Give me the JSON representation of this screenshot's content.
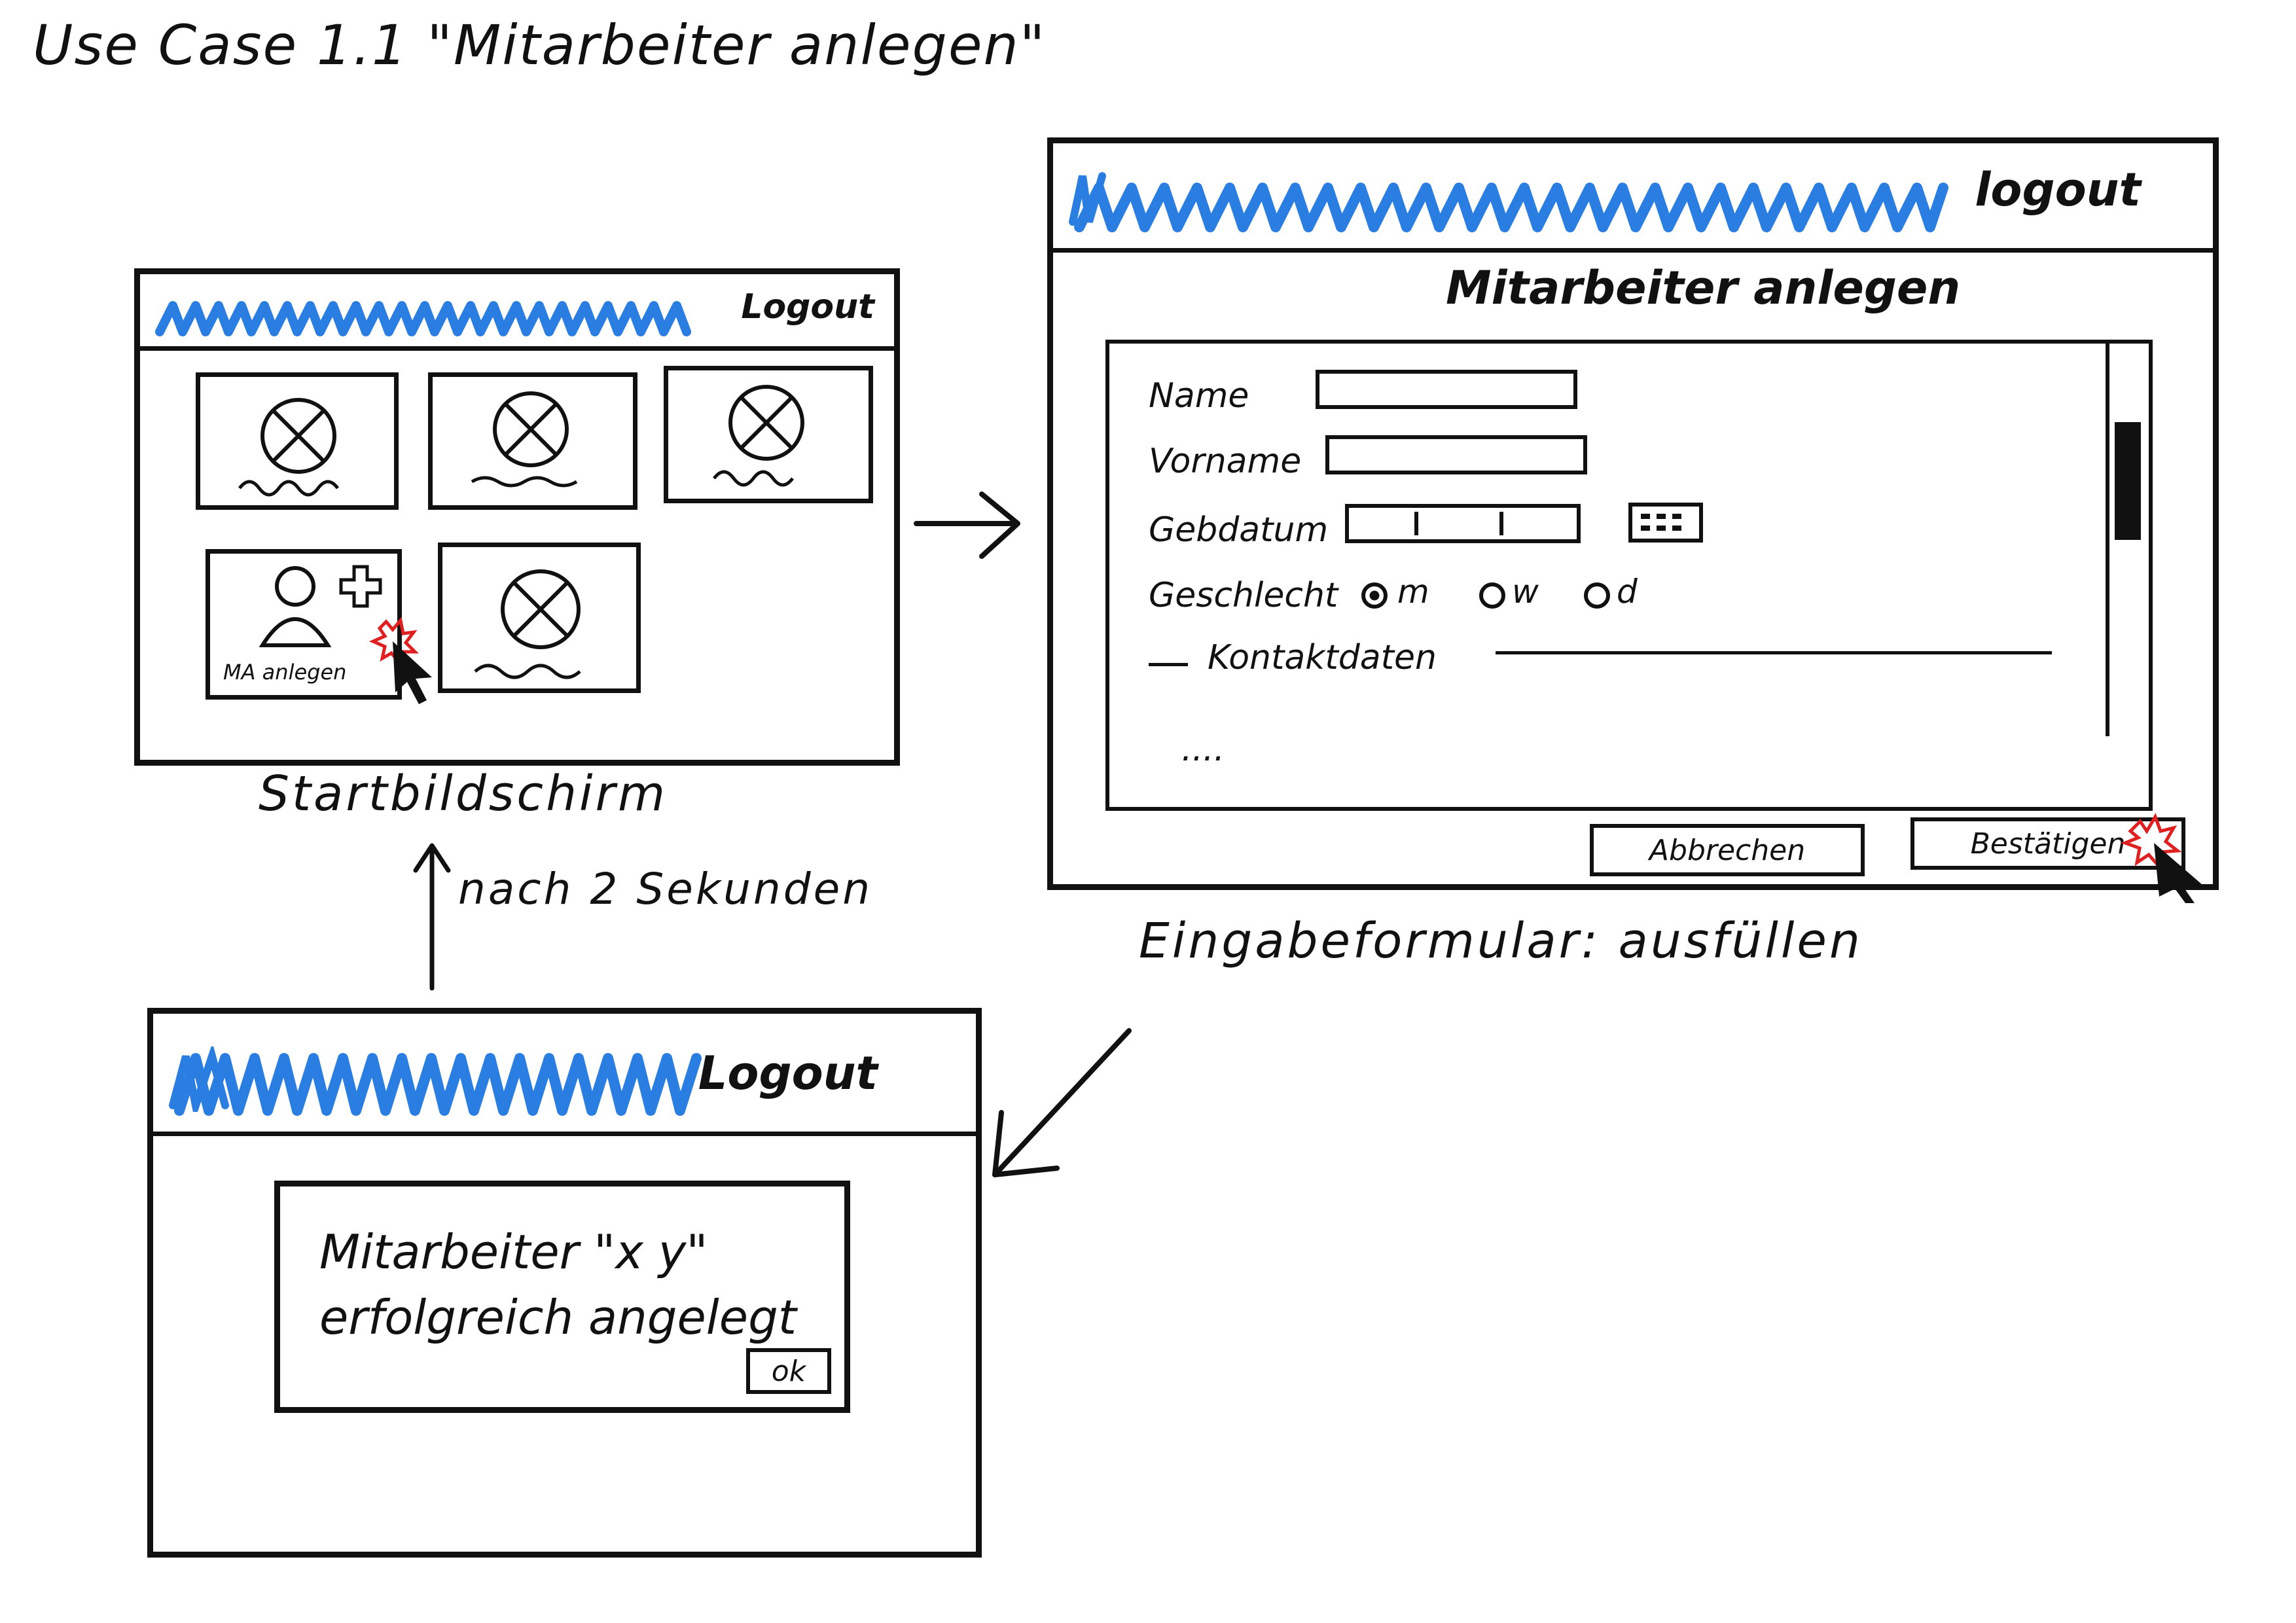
{
  "title": "Use Case 1.1 \"Mitarbeiter anlegen\"",
  "colors": {
    "brand_scribble": "#2a7de1",
    "ink": "#111111",
    "highlight": "#e02020"
  },
  "start_screen": {
    "logout_label": "Logout",
    "tile_add_label": "MA anlegen",
    "caption": "Startbildschirm"
  },
  "transition_label": "nach 2 Sekunden",
  "form_screen": {
    "logout_label": "logout",
    "heading": "Mitarbeiter anlegen",
    "fields": {
      "name_label": "Name",
      "vorname_label": "Vorname",
      "geburtsdatum_label": "Gebdatum",
      "geschlecht_label": "Geschlecht"
    },
    "gender_options": {
      "m": "m",
      "w": "w",
      "d": "d"
    },
    "section_kontakt": "Kontaktdaten",
    "ellipsis": "....",
    "cancel_label": "Abbrechen",
    "confirm_label": "Bestätigen",
    "caption": "Eingabeformular: ausfüllen"
  },
  "confirm_screen": {
    "logout_label": "Logout",
    "message_line1": "Mitarbeiter \"x y\"",
    "message_line2": "erfolgreich angelegt",
    "ok_label": "ok"
  }
}
